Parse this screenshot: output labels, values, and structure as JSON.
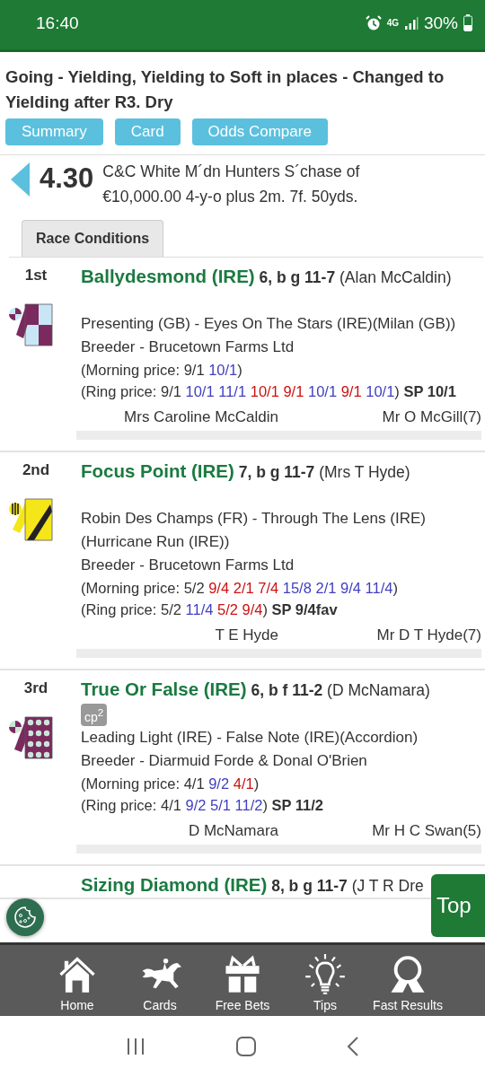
{
  "status_bar": {
    "time": "16:40",
    "network": "4G",
    "battery": "30%"
  },
  "going": "Going - Yielding, Yielding to Soft in places - Changed to Yielding after R3. Dry",
  "buttons": [
    "Summary",
    "Card",
    "Odds Compare"
  ],
  "race": {
    "time": "4.30",
    "title": "C&C White M´dn Hunters S´chase of €10,000.00 4-y-o plus 2m. 7f. 50yds."
  },
  "tabs": [
    {
      "label": "Race Conditions",
      "selected": true
    }
  ],
  "runners": [
    {
      "position": "1st",
      "name": "Ballydesmond (IRE)",
      "details": "6, b g 11-7",
      "owner": "(Alan McCaldin)",
      "kind": "quartered",
      "breeding": "Presenting (GB) - Eyes On The Stars (IRE)(Milan (GB))",
      "breeder": "Breeder - Brucetown Farms Ltd",
      "morning": {
        "open": "(Morning price:",
        "prices": [
          {
            "text": "9/1",
            "color": "#333333"
          },
          {
            "text": "10/1",
            "color": "#4040c0"
          }
        ],
        "close": ")"
      },
      "ring": {
        "open": "(Ring price:",
        "prices": [
          {
            "text": "9/1",
            "color": "#333333"
          },
          {
            "text": "10/1",
            "color": "#4040c0"
          },
          {
            "text": "11/1",
            "color": "#4040c0"
          },
          {
            "text": "10/1",
            "color": "#cc1111"
          },
          {
            "text": "9/1",
            "color": "#cc1111"
          },
          {
            "text": "10/1",
            "color": "#4040c0"
          },
          {
            "text": "9/1",
            "color": "#cc1111"
          },
          {
            "text": "10/1",
            "color": "#4040c0"
          }
        ],
        "close": ")",
        "sp": "SP 10/1"
      },
      "trainer": "Mrs Caroline McCaldin",
      "jockey": "Mr O McGill(7)"
    },
    {
      "position": "2nd",
      "name": "Focus Point (IRE)",
      "details": "7, b g 11-7",
      "owner": "(Mrs T Hyde)",
      "kind": "sash",
      "breeding": "Robin Des Champs (FR) - Through The Lens (IRE)(Hurricane Run (IRE))",
      "breeder": "Breeder - Brucetown Farms Ltd",
      "morning": {
        "open": "(Morning price:",
        "prices": [
          {
            "text": "5/2",
            "color": "#333333"
          },
          {
            "text": "9/4",
            "color": "#cc1111"
          },
          {
            "text": "2/1",
            "color": "#cc1111"
          },
          {
            "text": "7/4",
            "color": "#cc1111"
          },
          {
            "text": "15/8",
            "color": "#4040c0"
          },
          {
            "text": "2/1",
            "color": "#4040c0"
          },
          {
            "text": "9/4",
            "color": "#4040c0"
          },
          {
            "text": "11/4",
            "color": "#4040c0"
          }
        ],
        "close": ")"
      },
      "ring": {
        "open": "(Ring price:",
        "prices": [
          {
            "text": "5/2",
            "color": "#333333"
          },
          {
            "text": "11/4",
            "color": "#4040c0"
          },
          {
            "text": "5/2",
            "color": "#cc1111"
          },
          {
            "text": "9/4",
            "color": "#cc1111"
          }
        ],
        "close": ")",
        "sp": "SP 9/4fav"
      },
      "trainer": "T E Hyde",
      "jockey": "Mr D T Hyde(7)"
    },
    {
      "position": "3rd",
      "name": "True Or False (IRE)",
      "details": "6, b f 11-2",
      "owner": "(D McNamara)",
      "badge": "cp$^{2}$",
      "kind": "spots",
      "breeding": "Leading Light (IRE) - False Note (IRE)(Accordion)",
      "breeder": "Breeder - Diarmuid Forde & Donal O'Brien",
      "morning": {
        "open": "(Morning price:",
        "prices": [
          {
            "text": "4/1",
            "color": "#333333"
          },
          {
            "text": "9/2",
            "color": "#4040c0"
          },
          {
            "text": "4/1",
            "color": "#cc1111"
          }
        ],
        "close": ")"
      },
      "ring": {
        "open": "(Ring price:",
        "prices": [
          {
            "text": "4/1",
            "color": "#333333"
          },
          {
            "text": "9/2",
            "color": "#4040c0"
          },
          {
            "text": "5/1",
            "color": "#4040c0"
          },
          {
            "text": "11/2",
            "color": "#4040c0"
          }
        ],
        "close": ")",
        "sp": "SP 11/2"
      },
      "trainer": "D McNamara",
      "jockey": "Mr H C Swan(5)"
    },
    {
      "name": "Sizing Diamond (IRE)",
      "details": "8, b g 11-7",
      "owner": "(J T R Dre"
    }
  ],
  "top_button": "Top",
  "nav": [
    {
      "label": "Home",
      "kind": "home"
    },
    {
      "label": "Cards",
      "kind": "horse"
    },
    {
      "label": "Free Bets",
      "kind": "gift"
    },
    {
      "label": "Tips",
      "kind": "bulb"
    },
    {
      "label": "Fast Results",
      "kind": "rosette"
    }
  ]
}
